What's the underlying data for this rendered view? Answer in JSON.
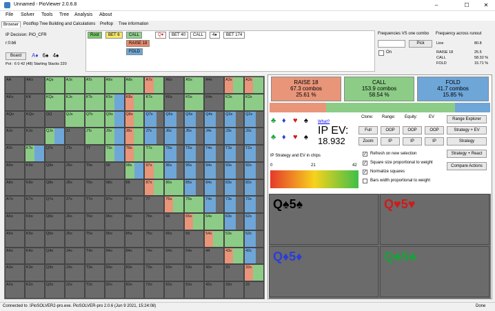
{
  "window": {
    "title": "Unnamed - PioViewer 2.0.6.8",
    "min": "–",
    "max": "☐",
    "close": "✕"
  },
  "menu": [
    "File",
    "Solver",
    "Tools",
    "Tree",
    "Analysis",
    "About"
  ],
  "tabs": [
    "Browser",
    "Postflop Tree Building and Calculations",
    "Preflop",
    "Tree information"
  ],
  "info": {
    "decision": "IP Decision:  PIO_CFR",
    "id": "r:0:b6",
    "board_label": "Board",
    "board_cards": [
      "A♦",
      "6♠",
      "4♠"
    ],
    "pot": "Pot : 6 0 42 (48)  Starting Stacks 220"
  },
  "tree_nodes": [
    {
      "label": "Root",
      "color": "#7dc96e"
    },
    {
      "label": "BET 6",
      "color": "#f5e96a"
    },
    {
      "label": "CALL",
      "color": "#8fd18f"
    },
    {
      "label": "RAISE 18",
      "color": "#e88a6a"
    },
    {
      "label": "FOLD",
      "color": "#6aa7d6"
    },
    {
      "label": "Q♥",
      "color": "#ffffff"
    },
    {
      "label": "BET 40",
      "color": "#ffffff"
    },
    {
      "label": "CALL",
      "color": "#ffffff"
    },
    {
      "label": "4♠",
      "color": "#ffffff"
    },
    {
      "label": "BET 174",
      "color": "#ffffff"
    }
  ],
  "freq": {
    "label": "Frequencies VS one combo",
    "pick": "Pick",
    "on": "On",
    "runout_label": "Frequency across runout",
    "line": "Line",
    "line_val": "80.8",
    "rows": [
      [
        "RAISE 18",
        "25.5"
      ],
      [
        "CALL",
        "58.32 %"
      ],
      [
        "FOLD",
        "15.71 %"
      ]
    ]
  },
  "actions": [
    {
      "name": "RAISE 18",
      "combos": "67.3 combos",
      "pct": "25.61 %",
      "color": "#e8957a"
    },
    {
      "name": "CALL",
      "combos": "153.9 combos",
      "pct": "58.54 %",
      "color": "#8ccc86"
    },
    {
      "name": "FOLD",
      "combos": "41.7 combos",
      "pct": "15.85 %",
      "color": "#6ea6d8"
    }
  ],
  "action_fractions": [
    0.2561,
    0.5854,
    0.1585
  ],
  "ev": {
    "what": "What?",
    "label": "IP EV:",
    "value": "18.932"
  },
  "cols": [
    "Clone:",
    "Range:",
    "Equity:",
    "EV"
  ],
  "btns": [
    [
      "Full",
      "OOP",
      "OOP",
      "OOP"
    ],
    [
      "Zoom",
      "IP",
      "IP",
      "IP"
    ]
  ],
  "right_btns": [
    "Range Explorer",
    "Strategy + EV",
    "Strategy",
    "Strategy + React",
    "Compare Actions"
  ],
  "checks": [
    {
      "label": "Refresh on new selection",
      "checked": true
    },
    {
      "label": "Square size proportional to weight",
      "checked": true
    },
    {
      "label": "Normalize squares",
      "checked": true
    },
    {
      "label": "Bars width proportional to weight",
      "checked": false
    }
  ],
  "scale": {
    "title": "IP Strategy and EV in chips",
    "ticks": [
      "0",
      "21",
      "42"
    ]
  },
  "combo_cells": [
    {
      "text": "Q♠5♠",
      "color": "#000000"
    },
    {
      "text": "Q♥5♥",
      "color": "#d01a1a"
    },
    {
      "text": "Q♦5♦",
      "color": "#2a3ed6"
    },
    {
      "text": "Q♣5♣",
      "color": "#19a23a"
    }
  ],
  "status": {
    "left": "Connected to .\\PioSOLVER2-pro.exe. PioSOLVER-pro 2.0.6 (Jun  9 2021, 15:24:08)",
    "right": "Done"
  },
  "matrix": {
    "ranks": [
      "A",
      "K",
      "Q",
      "J",
      "T",
      "9",
      "8",
      "7",
      "6",
      "5",
      "4",
      "3",
      "2"
    ],
    "dark": [
      "AKs",
      "A6s",
      "A4s",
      "AA",
      "AKo",
      "A6o",
      "A4o",
      "KK",
      "K6s",
      "K4s",
      "QQ",
      "JJ",
      "TT",
      "99",
      "88",
      "77",
      "66",
      "55",
      "44",
      "33",
      "22"
    ],
    "mixed_raise": [
      "A7s",
      "A3s",
      "A2s",
      "K8s",
      "Q8s",
      "J8s",
      "T8s",
      "97s",
      "87s",
      "76s",
      "65s",
      "54s",
      "43s",
      "32s"
    ],
    "mixed_fold": [
      "K9s",
      "Q9s",
      "J9s",
      "T9s",
      "98s",
      "KTo",
      "QJo"
    ],
    "fold_heavy": [
      "Q7s",
      "Q6s",
      "Q5s",
      "Q4s",
      "Q3s",
      "Q2s",
      "J7s",
      "J6s",
      "J5s",
      "J4s",
      "J3s",
      "J2s",
      "T6s",
      "T5s",
      "T4s",
      "T3s",
      "T2s",
      "96s",
      "95s",
      "94s",
      "93s",
      "92s",
      "85s",
      "84s",
      "83s",
      "82s",
      "74s",
      "73s",
      "72s",
      "63s",
      "62s",
      "52s",
      "42s"
    ]
  }
}
